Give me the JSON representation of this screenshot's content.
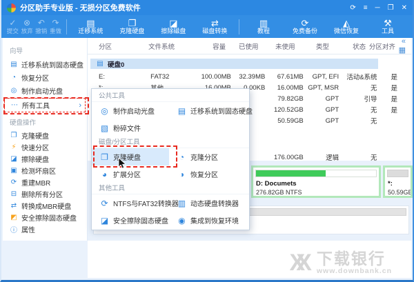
{
  "window": {
    "title": "分区助手专业版 - 无损分区免费软件",
    "controls": {
      "refresh": "⟳",
      "menu": "≡",
      "minimize": "─",
      "maximize": "❐",
      "close": "✕"
    }
  },
  "toolbar": {
    "pending": [
      {
        "label": "提交",
        "glyph": "✓"
      },
      {
        "label": "放弃",
        "glyph": "⊗"
      },
      {
        "label": "撤销",
        "glyph": "↶"
      },
      {
        "label": "重做",
        "glyph": "↷"
      }
    ],
    "actions": [
      {
        "label": "迁移系统"
      },
      {
        "label": "克隆硬盘"
      },
      {
        "label": "擦除磁盘"
      },
      {
        "label": "磁盘转换"
      },
      {
        "label": "教程"
      },
      {
        "label": "免费备份"
      },
      {
        "label": "微信恢复"
      },
      {
        "label": "工具"
      }
    ]
  },
  "sidebar": {
    "sections": [
      {
        "title": "向导",
        "items": [
          "迁移系统到固态硬盘",
          "恢复分区",
          "制作启动光盘",
          "所有工具"
        ]
      },
      {
        "title": "硬盘操作",
        "items": [
          "克隆硬盘",
          "快速分区",
          "擦除硬盘",
          "检测坏扇区",
          "重建MBR",
          "删除所有分区",
          "转换成MBR硬盘",
          "安全擦除固态硬盘",
          "属性"
        ]
      }
    ],
    "all_tools_arrow": "›"
  },
  "table": {
    "headers": [
      "分区",
      "文件系统",
      "容量",
      "已使用",
      "未使用",
      "类型",
      "状态",
      "分区对齐"
    ],
    "collapse_icon": "«",
    "grid_icon": "▦",
    "disk_group": "硬盘0",
    "rows": [
      {
        "partition": "E:",
        "fs": "FAT32",
        "capacity": "100.00MB",
        "used": "32.39MB",
        "unused": "67.61MB",
        "type": "GPT, EFI",
        "status": "活动&系统",
        "aligned": "是"
      },
      {
        "partition": "*:",
        "fs": "其他",
        "capacity": "16.00MB",
        "used": "0.00KB",
        "unused": "16.00MB",
        "type": "GPT, MSR",
        "status": "无",
        "aligned": "是"
      },
      {
        "partition": "",
        "fs": "",
        "capacity": "",
        "used": "",
        "unused": "79.82GB",
        "type": "GPT",
        "status": "引导",
        "aligned": "是"
      },
      {
        "partition": "",
        "fs": "",
        "capacity": "",
        "used": "",
        "unused": "120.52GB",
        "type": "GPT",
        "status": "无",
        "aligned": "是"
      },
      {
        "partition": "",
        "fs": "",
        "capacity": "",
        "used": "",
        "unused": "50.59GB",
        "type": "GPT",
        "status": "无",
        "aligned": ""
      },
      {
        "partition": "",
        "fs": "",
        "capacity": "",
        "used": "",
        "unused": "176.00GB",
        "type": "逻辑",
        "status": "无",
        "aligned": ""
      }
    ]
  },
  "menu": {
    "sections": [
      {
        "title": "公共工具",
        "items": [
          {
            "label": "制作启动光盘"
          },
          {
            "label": "迁移系统到固态硬盘"
          },
          {
            "label": "粉碎文件"
          }
        ]
      },
      {
        "title": "磁盘/分区工具",
        "items": [
          {
            "label": "克隆硬盘"
          },
          {
            "label": "克隆分区"
          },
          {
            "label": "扩展分区"
          },
          {
            "label": "恢复分区"
          }
        ]
      },
      {
        "title": "其他工具",
        "items": [
          {
            "label": "NTFS与FAT32转换器"
          },
          {
            "label": "动态硬盘转换器"
          },
          {
            "label": "安全擦除固态硬盘"
          },
          {
            "label": "集成到恢复环境"
          }
        ]
      }
    ]
  },
  "disks_view": {
    "disk0_blocks": [
      {
        "label": "",
        "size": "",
        "fill_percent": 0
      },
      {
        "label": "D: Documets",
        "size": "276.82GB NTFS",
        "fill_percent": 58
      },
      {
        "label": "*:",
        "size": "50.59GB...",
        "fill_percent": 0
      }
    ]
  },
  "watermark": {
    "logo_text": "XX",
    "brand": "下载银行",
    "site": "www.downbank.cn"
  },
  "colors": {
    "titlebar": "#2c88e2",
    "accent_blue": "#2f86dd",
    "highlight_red": "#e8281e",
    "green_border": "#b2e8ba",
    "green_fill": "#3fcb5a"
  }
}
